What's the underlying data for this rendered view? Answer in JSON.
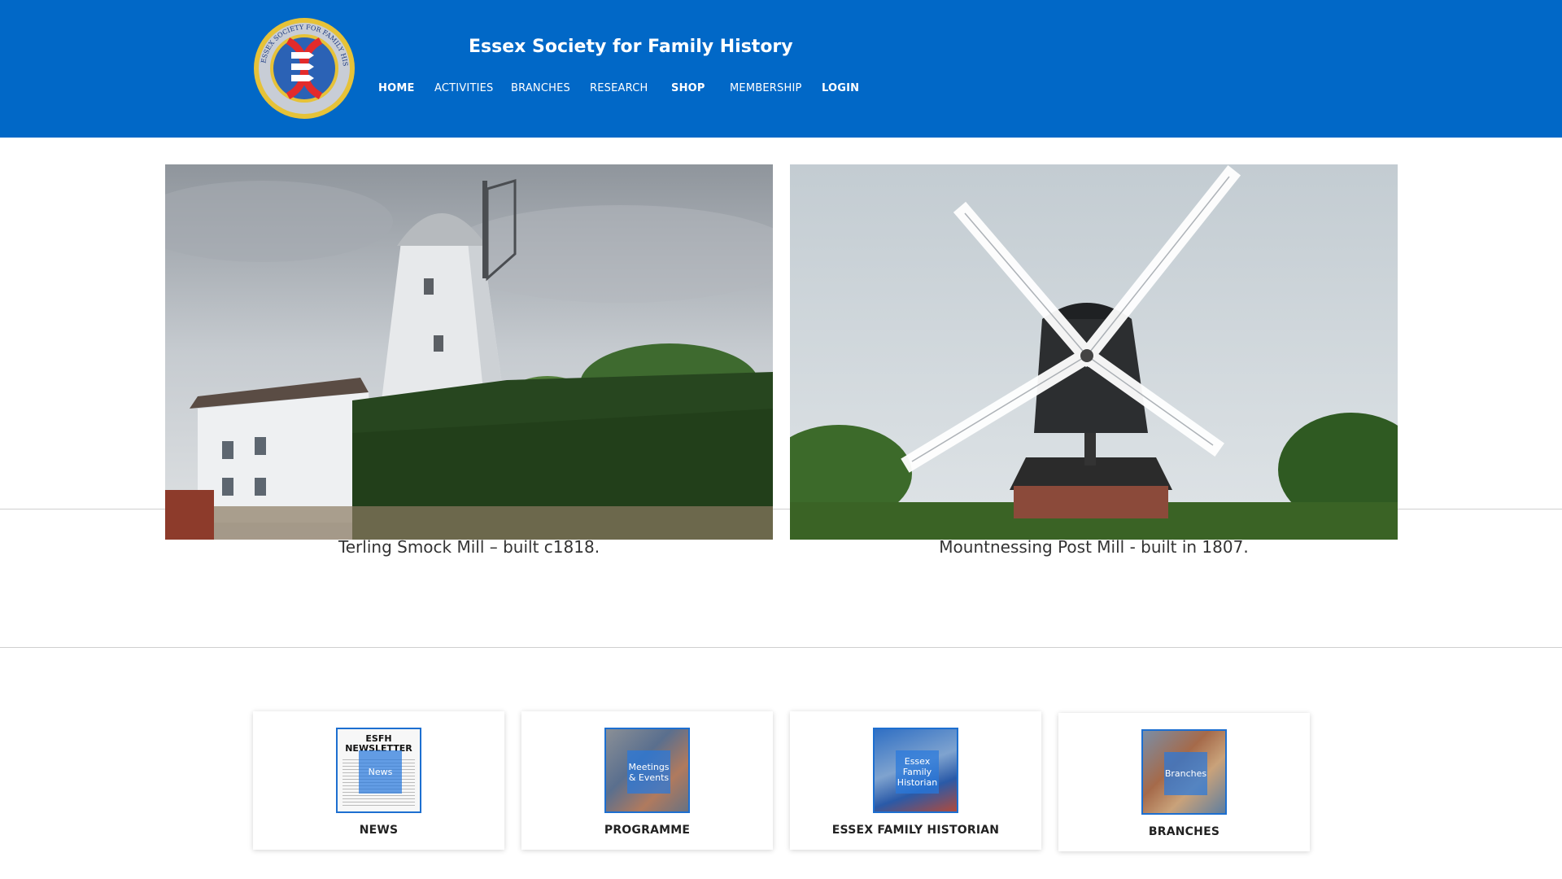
{
  "site": {
    "title": "Essex Society for Family History",
    "logo_text": "ESSEX SOCIETY FOR FAMILY HISTORY",
    "brand_color": "#0168c7"
  },
  "nav": [
    {
      "label": "HOME"
    },
    {
      "label": "ACTIVITIES"
    },
    {
      "label": "BRANCHES"
    },
    {
      "label": "RESEARCH"
    },
    {
      "label": "SHOP"
    },
    {
      "label": "MEMBERSHIP"
    },
    {
      "label": "LOGIN"
    }
  ],
  "slides": [
    {
      "caption": "Terling Smock Mill – built c1818."
    },
    {
      "caption": "Mountnessing Post Mill - built in 1807."
    }
  ],
  "cards": [
    {
      "label": "NEWS",
      "overlay": "News",
      "thumb_title": "ESFH NEWSLETTER"
    },
    {
      "label": "PROGRAMME",
      "overlay": "Meetings & Events"
    },
    {
      "label": "ESSEX FAMILY HISTORIAN",
      "overlay": "Essex Family Historian"
    },
    {
      "label": "BRANCHES",
      "overlay": "Branches"
    }
  ]
}
